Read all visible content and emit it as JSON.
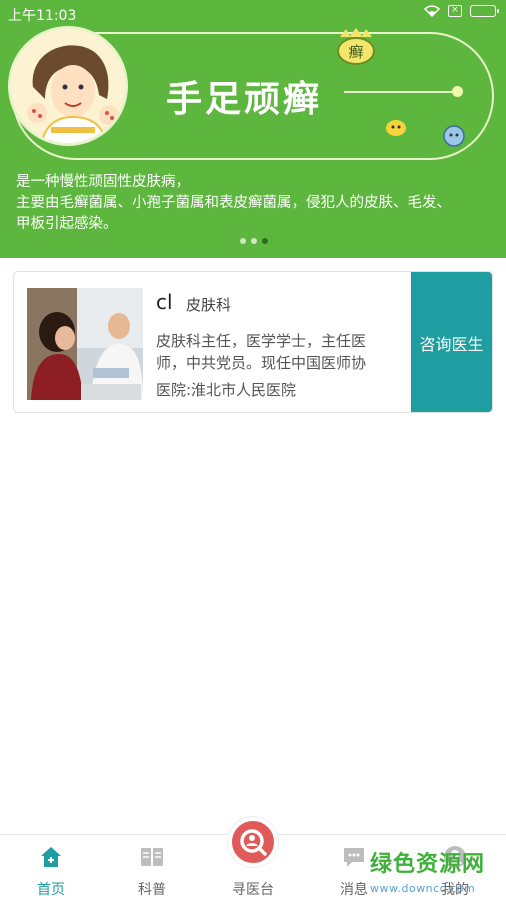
{
  "status_bar": {
    "time": "上午11:03",
    "sim_label": "×"
  },
  "banner": {
    "title": "手足顽癣",
    "badge": "癣",
    "description": [
      "是一种慢性顽固性皮肤病，",
      "主要由毛癣菌属、小孢子菌属和表皮癣菌属，侵犯人的皮肤、毛发、",
      "甲板引起感染。"
    ],
    "slide_count": 3,
    "active_slide": 3
  },
  "doctor": {
    "name": "cl",
    "department": "皮肤科",
    "bio_line1": "皮肤科主任，医学学士，主任医",
    "bio_line2": "师，中共党员。现任中国医师协",
    "hospital": "医院:淮北市人民医院",
    "consult_label": "咨询医生"
  },
  "bottom_nav": {
    "items": [
      {
        "label": "首页",
        "icon": "home-icon",
        "active": true
      },
      {
        "label": "科普",
        "icon": "book-icon",
        "active": false
      },
      {
        "label": "寻医台",
        "icon": "search-doctor-icon",
        "active": false
      },
      {
        "label": "消息",
        "icon": "message-icon",
        "active": false
      },
      {
        "label": "我的",
        "icon": "profile-icon",
        "active": false
      }
    ]
  },
  "watermark": {
    "title": "绿色资源网",
    "url": "www.downcc.com"
  },
  "colors": {
    "banner_green": "#5db63d",
    "accent_teal": "#1e9ea0",
    "center_red": "#e05a5a"
  }
}
